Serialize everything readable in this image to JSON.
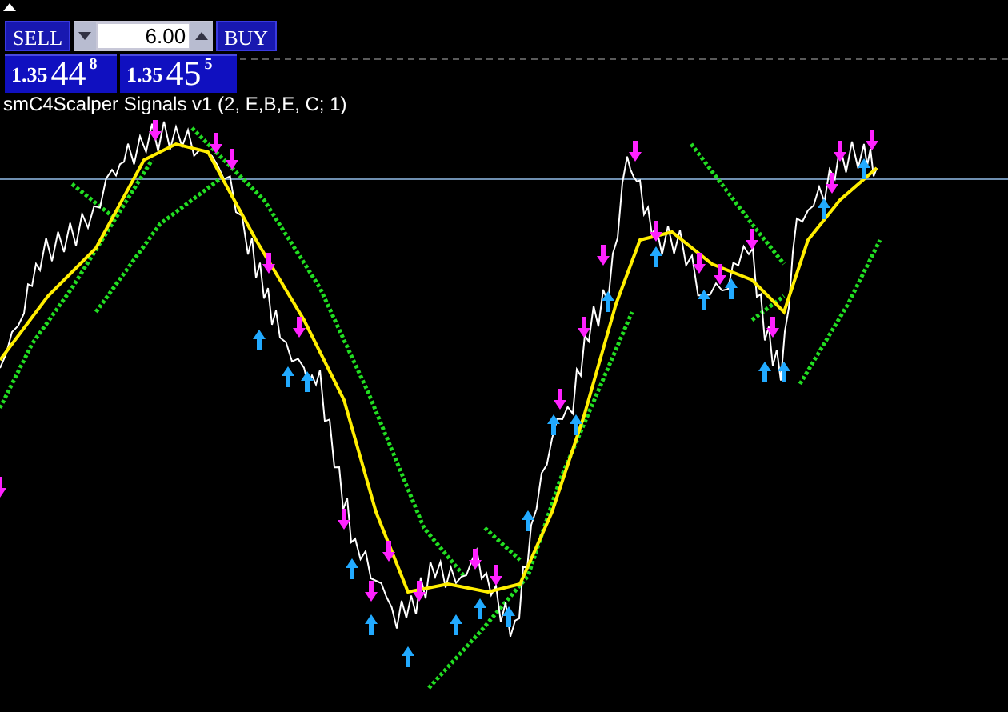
{
  "trade_panel": {
    "sell_label": "SELL",
    "lot_size": "6.00",
    "buy_label": "BUY",
    "bid": {
      "prefix": "1.35",
      "big": "44",
      "small": "8"
    },
    "ask": {
      "prefix": "1.35",
      "big": "45",
      "small": "5"
    }
  },
  "indicator_label": "smC4Scalper Signals v1 (2, E,B,E, C; 1)"
}
